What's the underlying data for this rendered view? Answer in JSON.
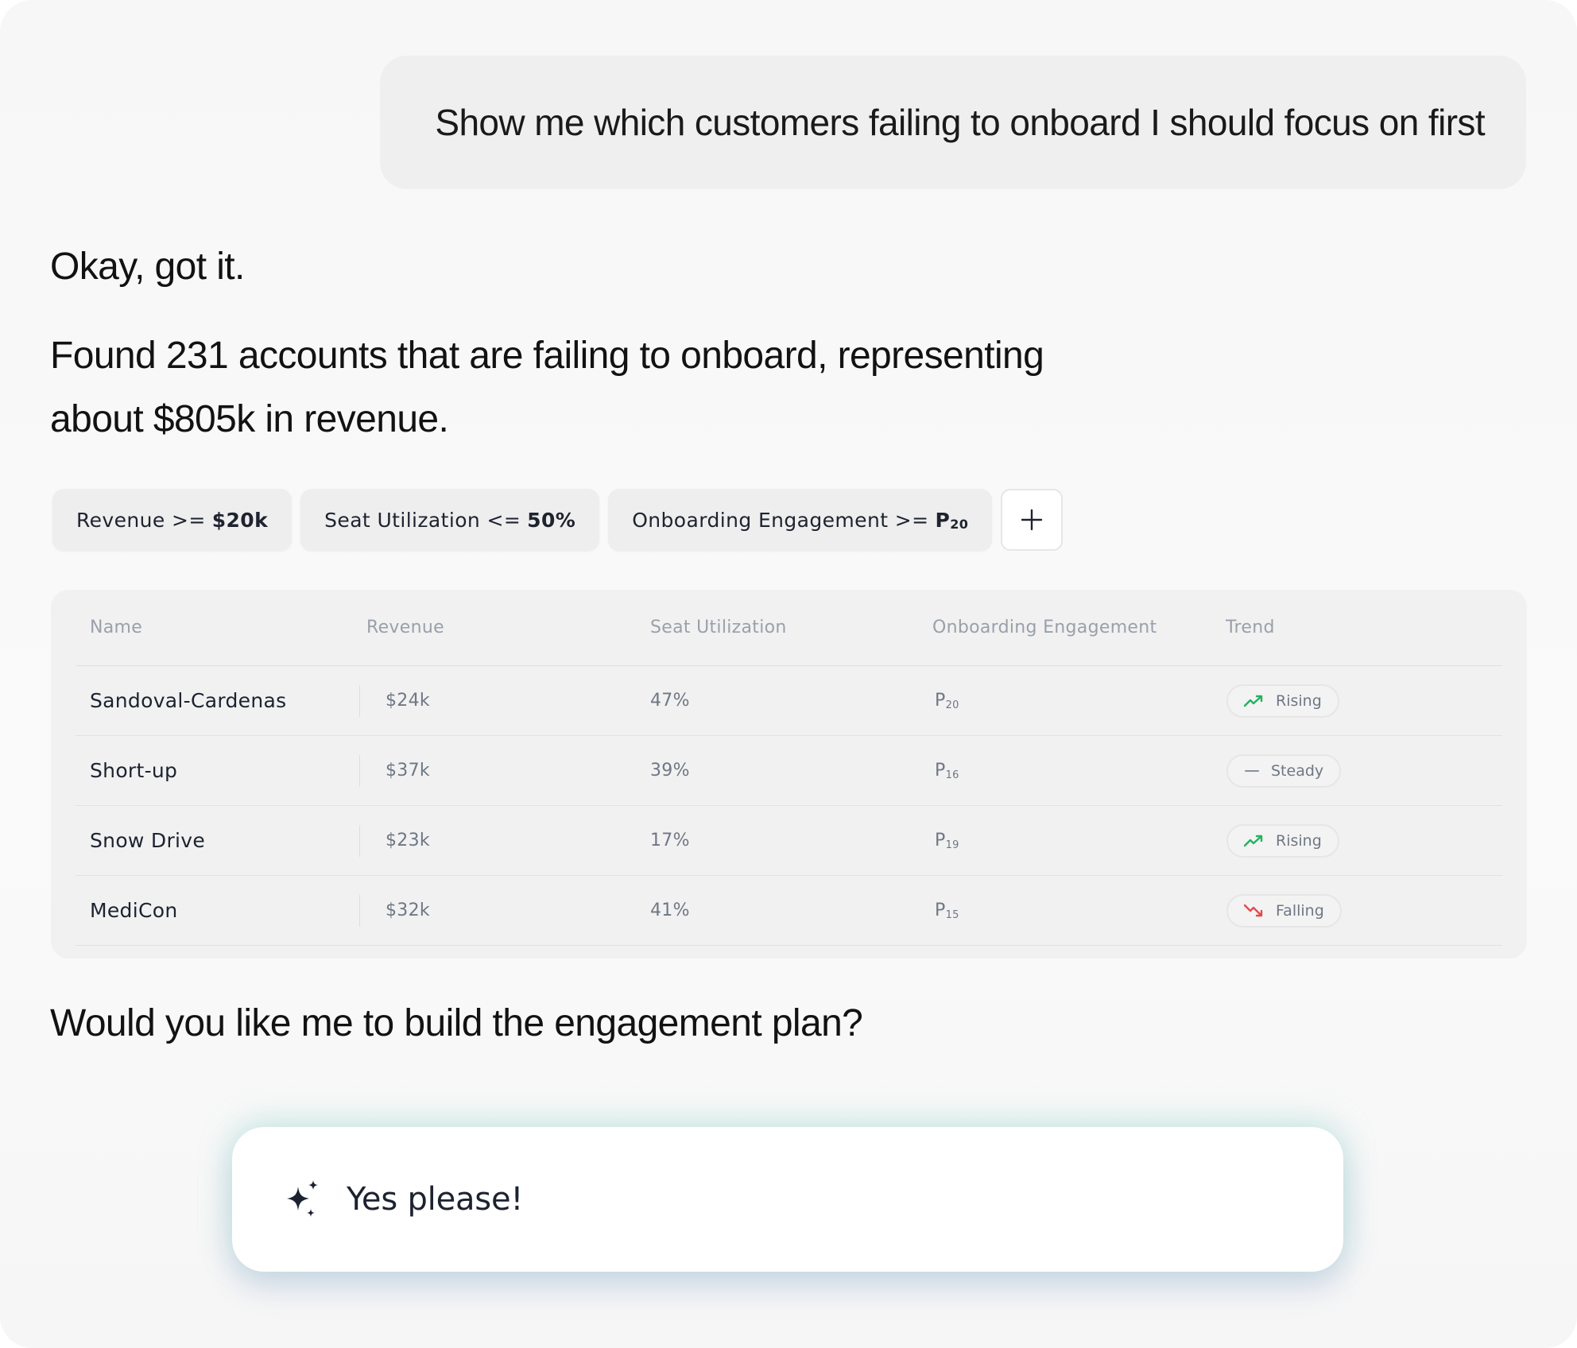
{
  "prompt": {
    "text": "Show me which customers failing to onboard I should focus on first"
  },
  "response": {
    "ack": "Okay, got it.",
    "found_line_1": "Found 231 accounts that are failing to onboard, representing",
    "found_line_2": "about $805k in revenue.",
    "question": "Would you like me to build the engagement plan?"
  },
  "filters": [
    {
      "label": "Revenue >=",
      "value": "$20k"
    },
    {
      "label": "Seat Utilization <=",
      "value": "50%"
    },
    {
      "label": "Onboarding Engagement >=",
      "value": "P",
      "sub": "20"
    }
  ],
  "add_filter_icon": "plus-icon",
  "table": {
    "headers": [
      "Name",
      "Revenue",
      "Seat Utilization",
      "Onboarding Engagement",
      "Trend"
    ],
    "rows": [
      {
        "name": "Sandoval-Cardenas",
        "revenue": "$24k",
        "seat": "47%",
        "eng": "P",
        "eng_sub": "20",
        "trend": "Rising",
        "trend_icon": "trending-up-icon",
        "trend_color": "#22b35e"
      },
      {
        "name": "Short-up",
        "revenue": "$37k",
        "seat": "39%",
        "eng": "P",
        "eng_sub": "16",
        "trend": "Steady",
        "trend_icon": "dash-icon",
        "trend_color": "#8a909a"
      },
      {
        "name": "Snow Drive",
        "revenue": "$23k",
        "seat": "17%",
        "eng": "P",
        "eng_sub": "19",
        "trend": "Rising",
        "trend_icon": "trending-up-icon",
        "trend_color": "#22b35e"
      },
      {
        "name": "MediCon",
        "revenue": "$32k",
        "seat": "41%",
        "eng": "P",
        "eng_sub": "15",
        "trend": "Falling",
        "trend_icon": "trending-down-icon",
        "trend_color": "#e5484d"
      }
    ]
  },
  "reply": {
    "label": "Yes please!",
    "icon": "sparkle-icon"
  }
}
